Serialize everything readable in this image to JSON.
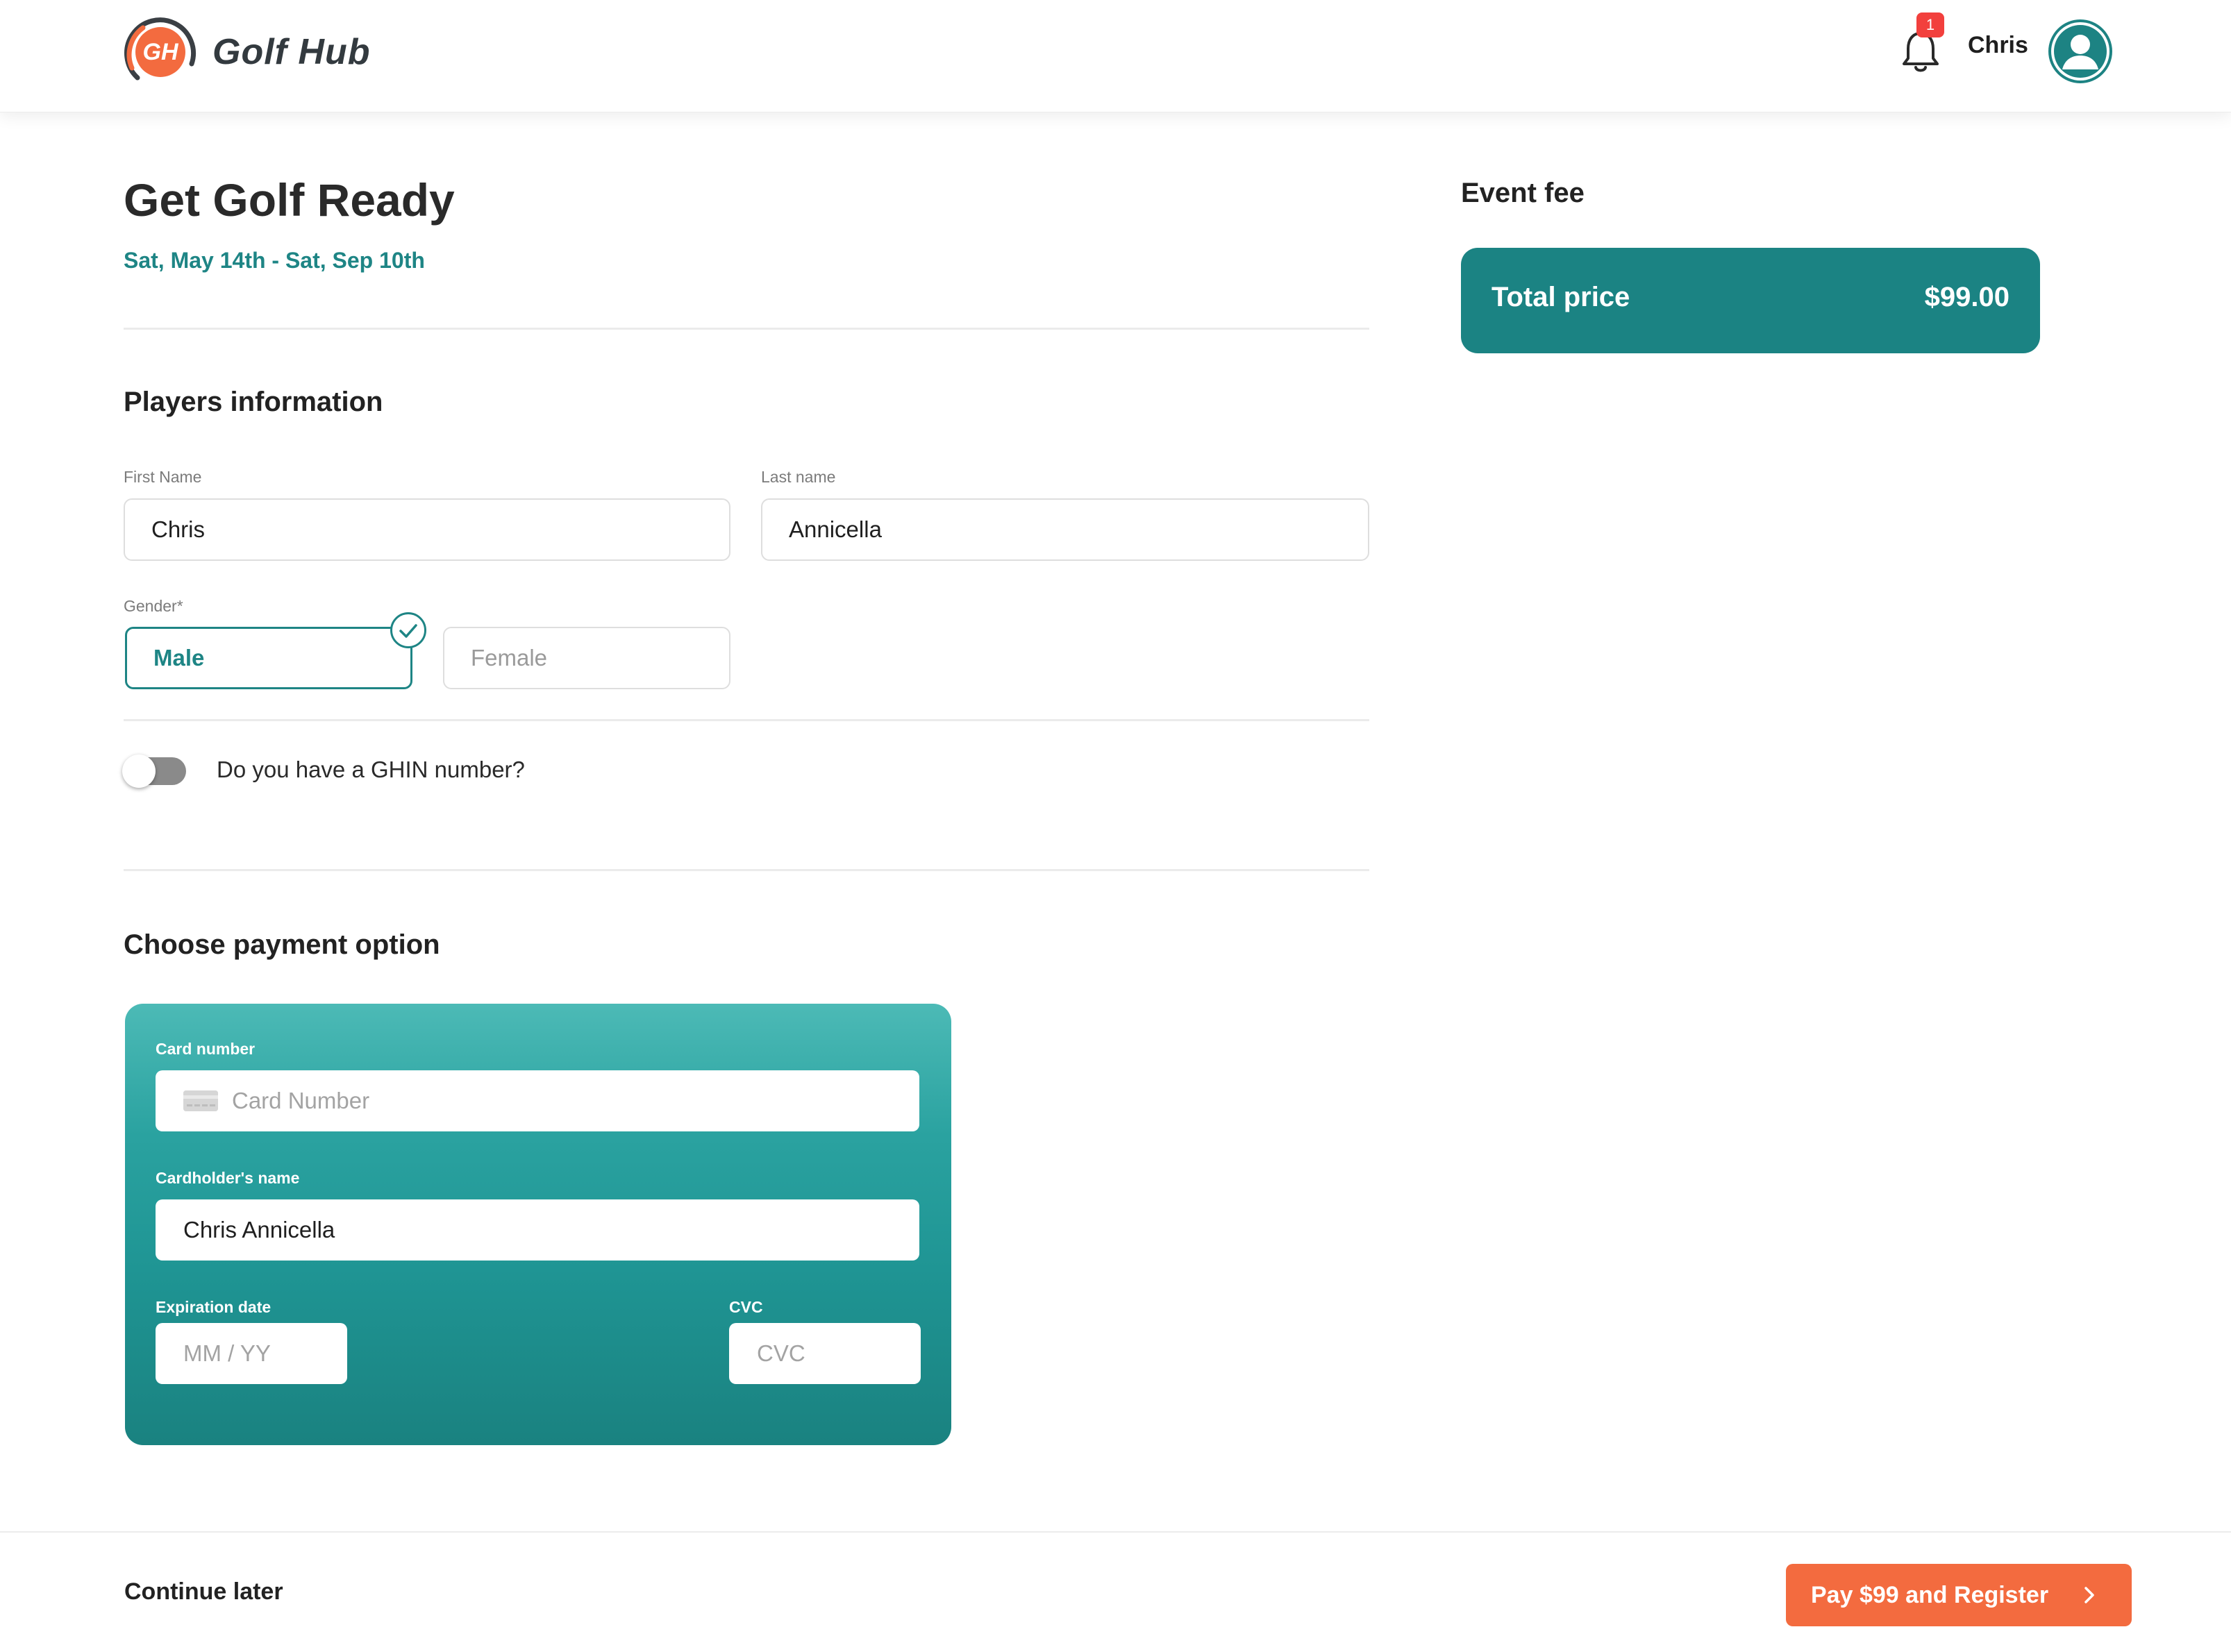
{
  "header": {
    "logo_initials": "GH",
    "logo_text": "Golf Hub",
    "notification_count": "1",
    "user_name": "Chris"
  },
  "event": {
    "title": "Get Golf Ready",
    "dates": "Sat, May 14th - Sat, Sep 10th"
  },
  "players": {
    "section_title": "Players information",
    "first_name_label": "First Name",
    "first_name_value": "Chris",
    "last_name_label": "Last name",
    "last_name_value": "Annicella",
    "gender_label": "Gender*",
    "gender_options": [
      "Male",
      "Female"
    ],
    "gender_selected": "Male",
    "ghin_toggle_label": "Do you have a GHIN number?",
    "ghin_toggle_on": false
  },
  "payment": {
    "section_title": "Choose payment option",
    "card_number_label": "Card number",
    "card_number_placeholder": "Card Number",
    "cardholder_label": "Cardholder's name",
    "cardholder_value": "Chris Annicella",
    "expiration_label": "Expiration date",
    "expiration_placeholder": "MM / YY",
    "cvc_label": "CVC",
    "cvc_placeholder": "CVC"
  },
  "fee": {
    "title": "Event fee",
    "total_label": "Total price",
    "total_value": "$99.00"
  },
  "footer": {
    "continue_later": "Continue later",
    "pay_button": "Pay $99 and Register"
  },
  "colors": {
    "brand_teal": "#1b8383",
    "accent_orange": "#f36b3f",
    "badge_red": "#f2403d"
  }
}
